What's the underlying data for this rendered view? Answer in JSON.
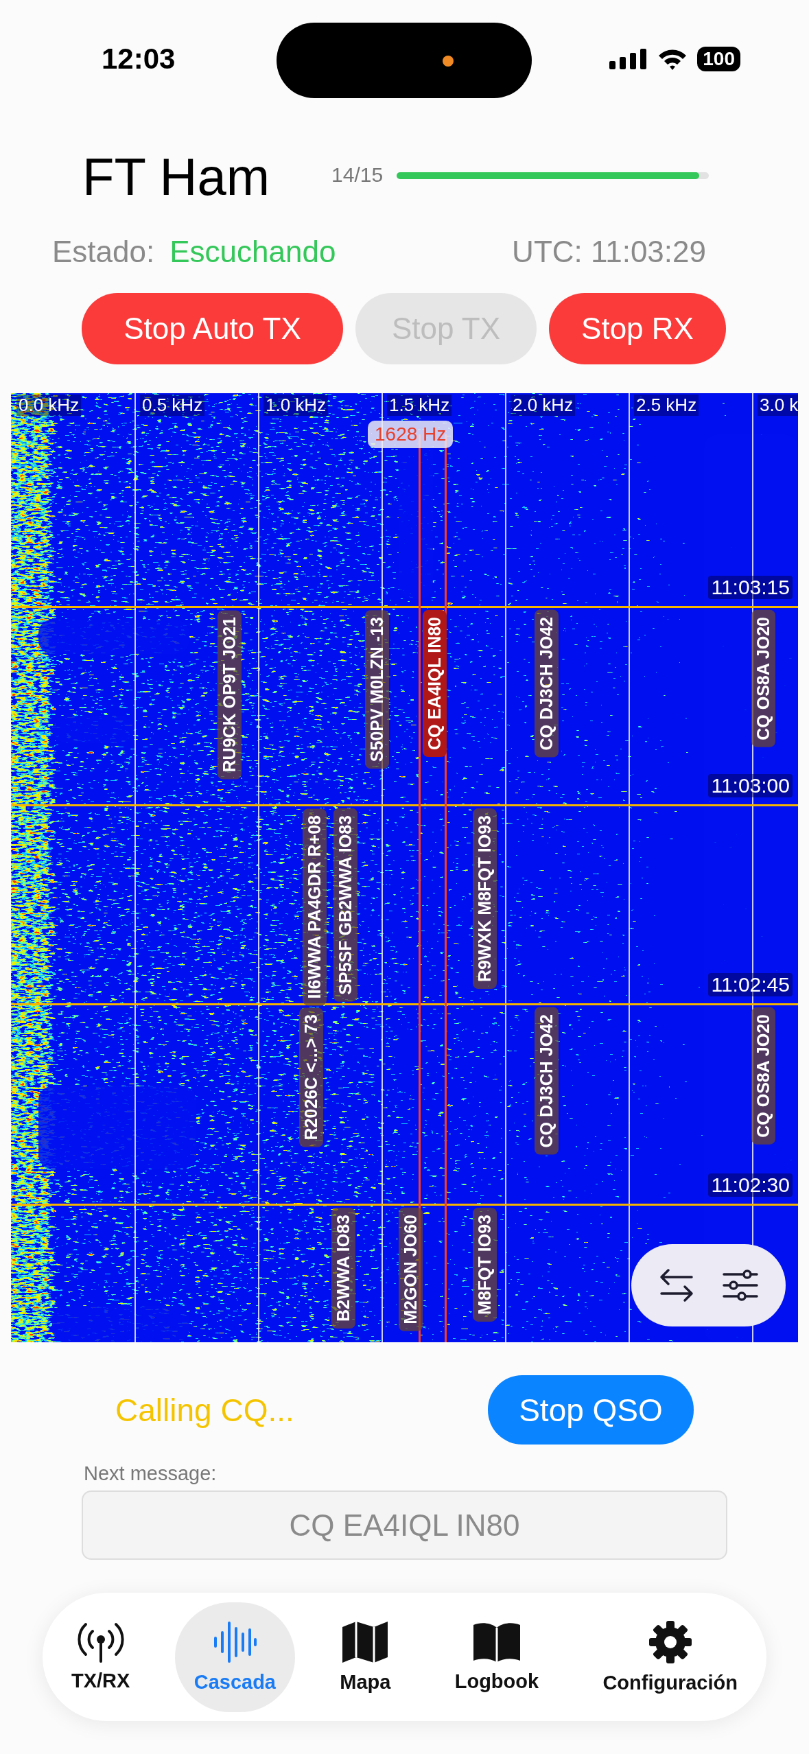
{
  "status_bar": {
    "time": "12:03",
    "battery": "100"
  },
  "header": {
    "title": "FT Ham",
    "cycle": "14/15",
    "level": 0.97
  },
  "status": {
    "label": "Estado:",
    "value": "Escuchando",
    "utc": "UTC: 11:03:29"
  },
  "controls": [
    {
      "label": "Stop Auto TX",
      "disabled": false
    },
    {
      "label": "Stop TX",
      "disabled": true
    },
    {
      "label": "Stop RX",
      "disabled": false
    }
  ],
  "waterfall": {
    "freq_labels": [
      "0.0 kHz",
      "0.5 kHz",
      "1.0 kHz",
      "1.5 kHz",
      "2.0 kHz",
      "2.5 kHz",
      "3.0 k"
    ],
    "marker": "1628 Hz",
    "slots": [
      {
        "time": "11:03:15"
      },
      {
        "time": "11:03:00",
        "decodes": [
          {
            "text": "RU9CK OP9T JO21",
            "selected": false
          },
          {
            "text": "S50PV M0LZN -13",
            "selected": false
          },
          {
            "text": "CQ EA4IQL IN80",
            "selected": true
          },
          {
            "text": "CQ DJ3CH JO42",
            "selected": false
          },
          {
            "text": "CQ OS8A JO20",
            "selected": false
          }
        ]
      },
      {
        "time": "11:02:45",
        "decodes": [
          {
            "text": "II6WWA PA4GDR R+08",
            "selected": false
          },
          {
            "text": "SP5SF GB2WWA IO83",
            "selected": false
          },
          {
            "text": "R9WXK M8FQT IO93",
            "selected": false
          }
        ]
      },
      {
        "time": "11:02:30",
        "decodes": [
          {
            "text": "R2026C <...> 73",
            "selected": false
          },
          {
            "text": "CQ DJ3CH JO42",
            "selected": false
          },
          {
            "text": "CQ OS8A JO20",
            "selected": false
          }
        ]
      },
      {
        "decodes": [
          {
            "text": "B2WWA IO83",
            "selected": false
          },
          {
            "text": "M2GON JO60",
            "selected": false
          },
          {
            "text": "M8FQT IO93",
            "selected": false
          }
        ]
      }
    ]
  },
  "qso": {
    "state": "Calling CQ...",
    "button": "Stop QSO"
  },
  "next_message": {
    "label": "Next message:",
    "value": "CQ EA4IQL IN80"
  },
  "tabs": [
    {
      "label": "TX/RX",
      "selected": false
    },
    {
      "label": "Cascada",
      "selected": true
    },
    {
      "label": "Mapa",
      "selected": false
    },
    {
      "label": "Logbook",
      "selected": false
    },
    {
      "label": "Configuración",
      "selected": false
    }
  ]
}
